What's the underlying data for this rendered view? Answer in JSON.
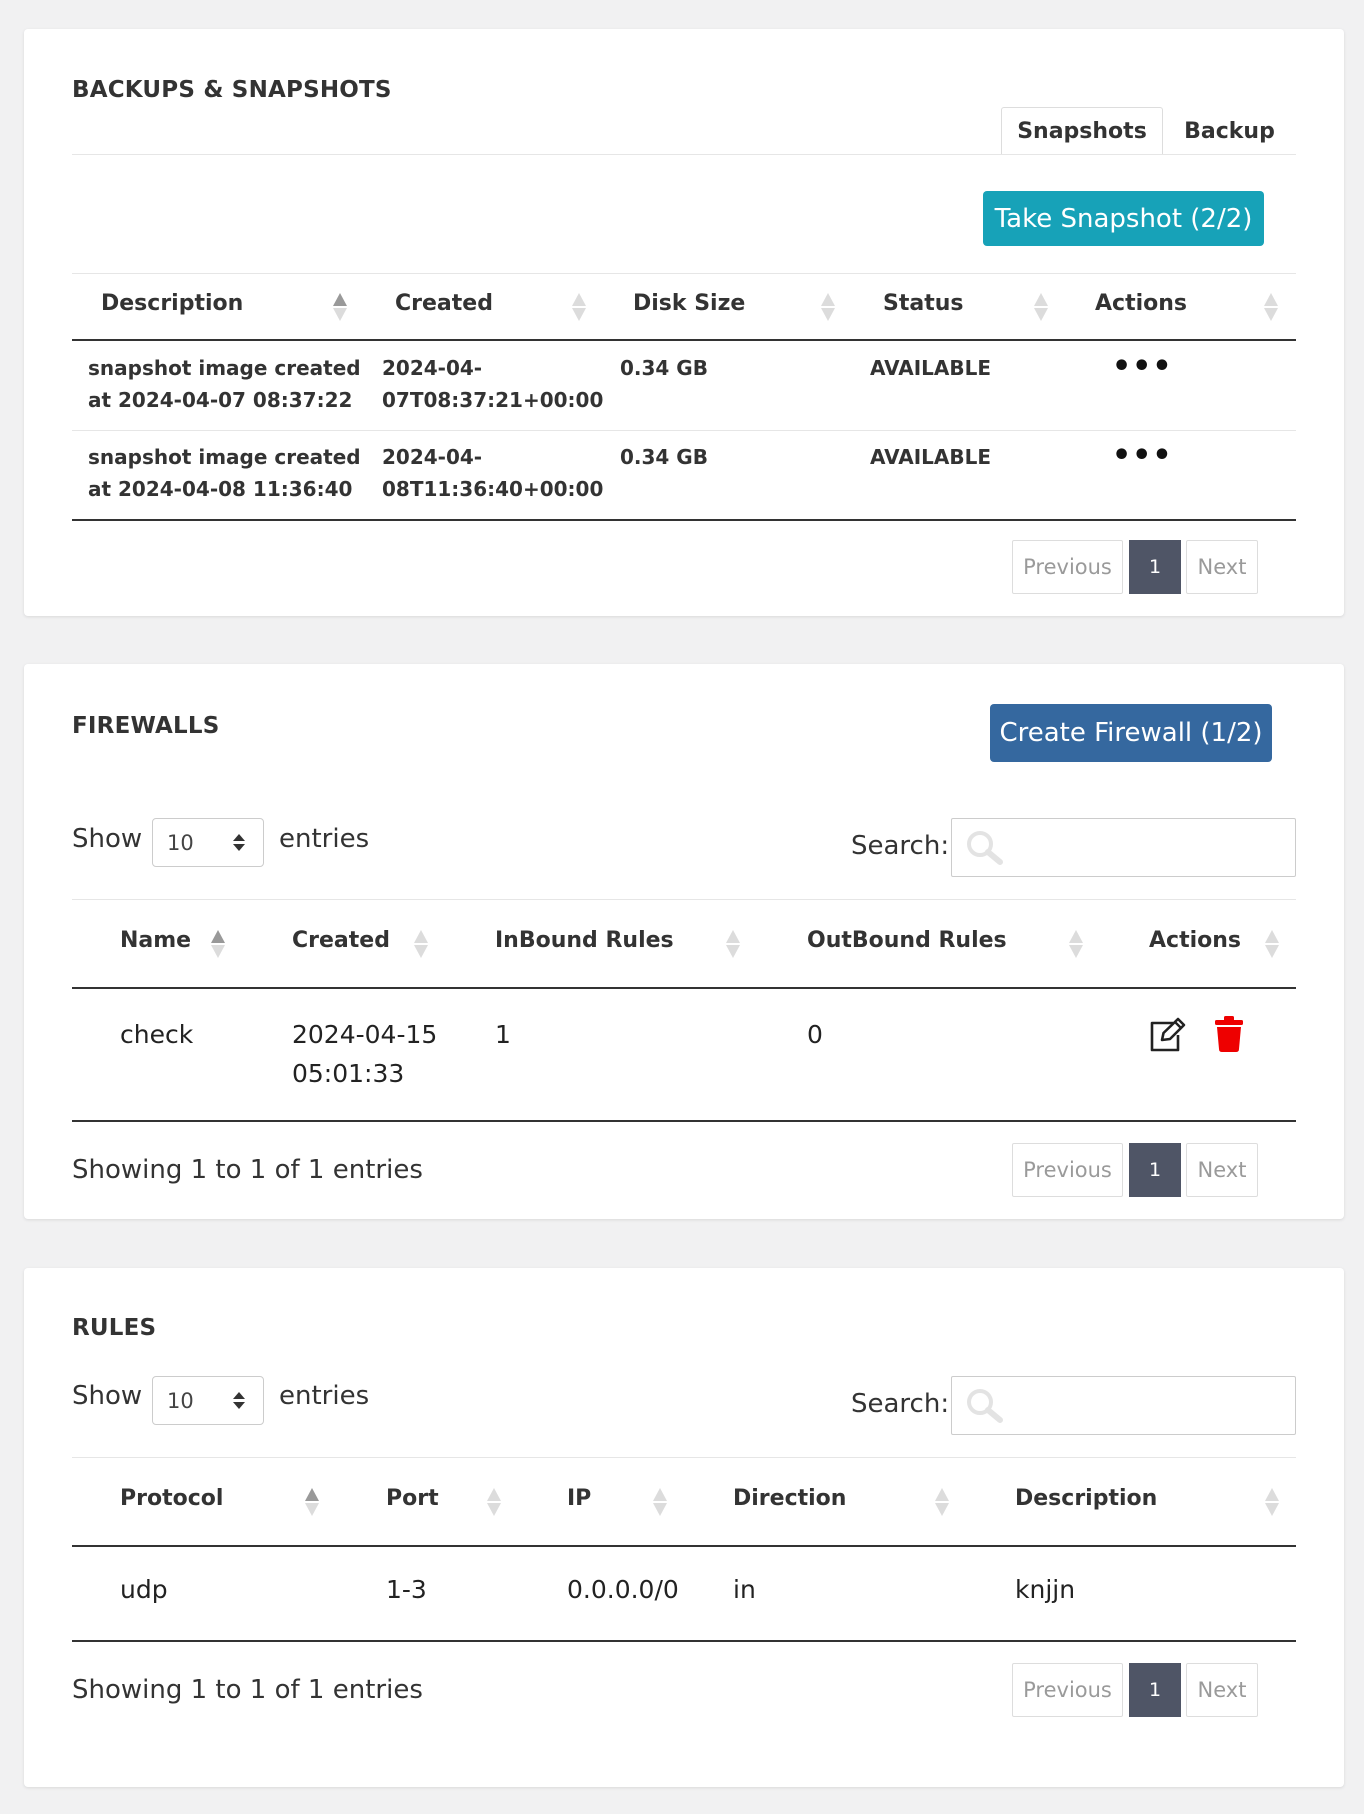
{
  "backups": {
    "title": "BACKUPS & SNAPSHOTS",
    "tabs": [
      {
        "label": "Snapshots",
        "active": true
      },
      {
        "label": "Backup",
        "active": false
      }
    ],
    "take_snapshot_label": "Take Snapshot (2/2)",
    "columns": [
      "Description",
      "Created",
      "Disk Size",
      "Status",
      "Actions"
    ],
    "rows": [
      {
        "description_line1": "snapshot image created",
        "description_line2": "at 2024-04-07 08:37:22",
        "created_line1": "2024-04-",
        "created_line2": "07T08:37:21+00:00",
        "disk_size": "0.34 GB",
        "status": "AVAILABLE",
        "actions": "•••"
      },
      {
        "description_line1": "snapshot image created",
        "description_line2": "at 2024-04-08 11:36:40",
        "created_line1": "2024-04-",
        "created_line2": "08T11:36:40+00:00",
        "disk_size": "0.34 GB",
        "status": "AVAILABLE",
        "actions": "•••"
      }
    ],
    "pagination": {
      "previous": "Previous",
      "current": "1",
      "next": "Next"
    }
  },
  "firewalls": {
    "title": "FIREWALLS",
    "create_label": "Create Firewall (1/2)",
    "show_label": "Show",
    "page_size": "10",
    "entries_label": "entries",
    "search_label": "Search:",
    "search_value": "",
    "columns": [
      "Name",
      "Created",
      "InBound Rules",
      "OutBound Rules",
      "Actions"
    ],
    "rows": [
      {
        "name": "check",
        "created_line1": "2024-04-15",
        "created_line2": "05:01:33",
        "inbound": "1",
        "outbound": "0"
      }
    ],
    "info": "Showing 1 to 1 of 1 entries",
    "pagination": {
      "previous": "Previous",
      "current": "1",
      "next": "Next"
    }
  },
  "rules": {
    "title": "RULES",
    "show_label": "Show",
    "page_size": "10",
    "entries_label": "entries",
    "search_label": "Search:",
    "search_value": "",
    "columns": [
      "Protocol",
      "Port",
      "IP",
      "Direction",
      "Description"
    ],
    "rows": [
      {
        "protocol": "udp",
        "port": "1-3",
        "ip": "0.0.0.0/0",
        "direction": "in",
        "description": "knjjn"
      }
    ],
    "info": "Showing 1 to 1 of 1 entries",
    "pagination": {
      "previous": "Previous",
      "current": "1",
      "next": "Next"
    }
  },
  "colors": {
    "snapshot_button": "#17a2b8",
    "firewall_button": "#35689f",
    "pagination_active": "#4f5566",
    "delete_icon": "#ee0000"
  },
  "icons": {
    "sort": "sort-icon",
    "search": "search-icon",
    "edit": "edit-icon",
    "delete": "trash-icon",
    "more": "more-icon"
  }
}
